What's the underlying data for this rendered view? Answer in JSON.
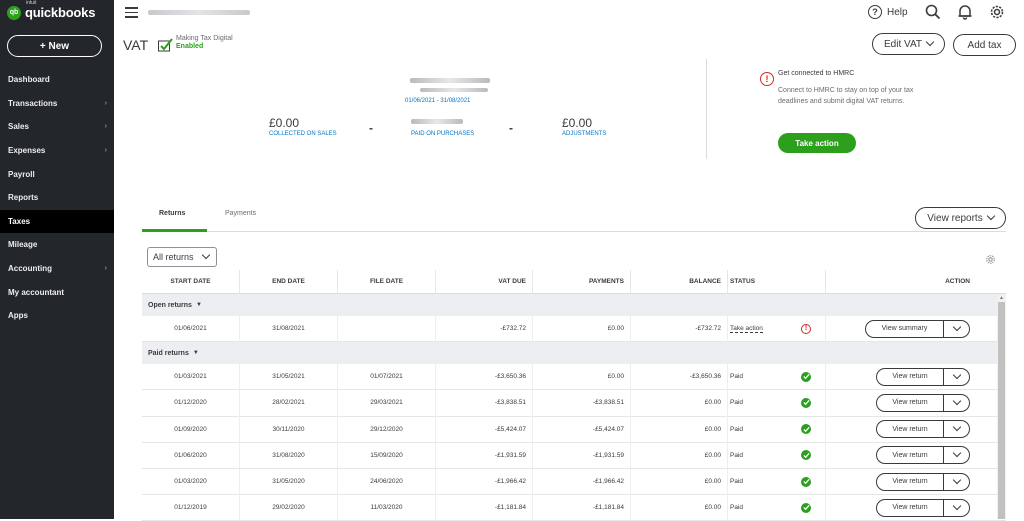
{
  "app": {
    "logo_sup": "intuit",
    "logo_text": "quickbooks",
    "new_button": "+ New"
  },
  "sidebar": {
    "items": [
      {
        "label": "Dashboard",
        "chevron": false,
        "active": false
      },
      {
        "label": "Transactions",
        "chevron": true,
        "active": false
      },
      {
        "label": "Sales",
        "chevron": true,
        "active": false
      },
      {
        "label": "Expenses",
        "chevron": true,
        "active": false
      },
      {
        "label": "Payroll",
        "chevron": false,
        "active": false
      },
      {
        "label": "Reports",
        "chevron": false,
        "active": false
      },
      {
        "label": "Taxes",
        "chevron": false,
        "active": true
      },
      {
        "label": "Mileage",
        "chevron": false,
        "active": false
      },
      {
        "label": "Accounting",
        "chevron": true,
        "active": false
      },
      {
        "label": "My accountant",
        "chevron": false,
        "active": false
      },
      {
        "label": "Apps",
        "chevron": false,
        "active": false
      }
    ]
  },
  "topbar": {
    "help_label": "Help",
    "icons": [
      "help-icon",
      "search-icon",
      "bell-icon",
      "gear-icon"
    ]
  },
  "page": {
    "title": "VAT",
    "mtd_label": "Making Tax Digital",
    "mtd_status": "Enabled",
    "edit_vat_button": "Edit VAT",
    "add_tax_button": "Add tax"
  },
  "summary": {
    "period": "01/06/2021 - 31/08/2021",
    "collected_amount": "£0.00",
    "collected_label": "COLLECTED ON SALES",
    "paid_label": "PAID ON PURCHASES",
    "adjustments_amount": "£0.00",
    "adjustments_label": "ADJUSTMENTS",
    "operator": "-"
  },
  "hmrc": {
    "title": "Get connected to HMRC",
    "body": "Connect to HMRC to stay on top of your tax deadlines and submit digital VAT returns.",
    "action_button": "Take action"
  },
  "tabs": {
    "returns": "Returns",
    "payments": "Payments",
    "view_reports": "View reports"
  },
  "filter": {
    "selected": "All returns"
  },
  "table": {
    "headers": [
      "START DATE",
      "END DATE",
      "FILE DATE",
      "VAT DUE",
      "PAYMENTS",
      "BALANCE",
      "STATUS",
      "ACTION"
    ],
    "open_group": "Open returns",
    "paid_group": "Paid returns",
    "open_rows": [
      {
        "start": "01/06/2021",
        "end": "31/08/2021",
        "file": "",
        "vat_due": "-£732.72",
        "payments": "£0.00",
        "balance": "-£732.72",
        "status": "Take action",
        "status_type": "warn",
        "action": "View summary"
      }
    ],
    "paid_rows": [
      {
        "start": "01/03/2021",
        "end": "31/05/2021",
        "file": "01/07/2021",
        "vat_due": "-£3,650.36",
        "payments": "£0.00",
        "balance": "-£3,650.36",
        "status": "Paid",
        "status_type": "ok",
        "action": "View return"
      },
      {
        "start": "01/12/2020",
        "end": "28/02/2021",
        "file": "29/03/2021",
        "vat_due": "-£3,838.51",
        "payments": "-£3,838.51",
        "balance": "£0.00",
        "status": "Paid",
        "status_type": "ok",
        "action": "View return"
      },
      {
        "start": "01/09/2020",
        "end": "30/11/2020",
        "file": "29/12/2020",
        "vat_due": "-£5,424.07",
        "payments": "-£5,424.07",
        "balance": "£0.00",
        "status": "Paid",
        "status_type": "ok",
        "action": "View return"
      },
      {
        "start": "01/06/2020",
        "end": "31/08/2020",
        "file": "15/09/2020",
        "vat_due": "-£1,931.59",
        "payments": "-£1,931.59",
        "balance": "£0.00",
        "status": "Paid",
        "status_type": "ok",
        "action": "View return"
      },
      {
        "start": "01/03/2020",
        "end": "31/05/2020",
        "file": "24/06/2020",
        "vat_due": "-£1,966.42",
        "payments": "-£1,966.42",
        "balance": "£0.00",
        "status": "Paid",
        "status_type": "ok",
        "action": "View return"
      },
      {
        "start": "01/12/2019",
        "end": "29/02/2020",
        "file": "11/03/2020",
        "vat_due": "-£1,181.84",
        "payments": "-£1,181.84",
        "balance": "£0.00",
        "status": "Paid",
        "status_type": "ok",
        "action": "View return"
      }
    ]
  },
  "colors": {
    "sidebar_bg": "#23262b",
    "brand_green": "#2ca01c",
    "link_blue": "#0077c5",
    "warning_red": "#d52b1e"
  }
}
